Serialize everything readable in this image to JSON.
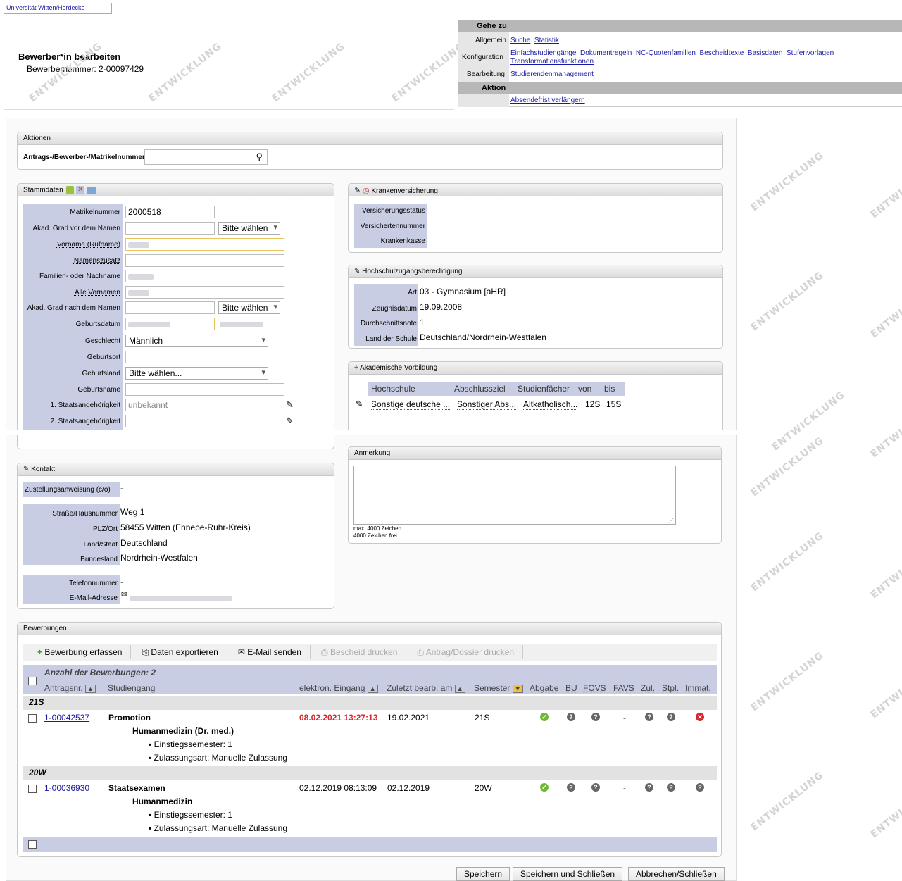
{
  "top": {
    "university_link": "Universität Witten/Herdecke",
    "page_title": "Bewerber*in bearbeiten",
    "applicant_number": "Bewerbernummer: 2-00097429",
    "watermark": "ENTWICKLUNG"
  },
  "nav": {
    "goto_header": "Gehe zu",
    "allgemein_label": "Allgemein",
    "allgemein_links": [
      "Suche",
      "Statistik"
    ],
    "konfiguration_label": "Konfiguration",
    "konfiguration_links": [
      "Einfachstudiengänge",
      "Dokumentregeln",
      "NC-Quotenfamilien",
      "Bescheidtexte",
      "Basisdaten",
      "Stufenvorlagen",
      "Transformationsfunktionen"
    ],
    "bearbeitung_label": "Bearbeitung",
    "bearbeitung_links": [
      "Studierendenmanagement"
    ],
    "aktion_header": "Aktion",
    "aktion_links": [
      "Absendefrist verlängern"
    ]
  },
  "aktionen": {
    "title": "Aktionen",
    "search_label": "Antrags-/Bewerber-/Matrikelnummer",
    "search_value": ""
  },
  "stammdaten": {
    "title": "Stammdaten",
    "fields": {
      "matrikelnummer_label": "Matrikelnummer",
      "matrikelnummer_value": "2000518",
      "grad_vor_label": "Akad. Grad vor dem Namen",
      "grad_vor_select": "Bitte wählen",
      "vorname_label": "Vorname (Rufname)",
      "namenszusatz_label": "Namenszusatz",
      "familienname_label": "Familien- oder Nachname",
      "alle_vornamen_label": "Alle Vornamen",
      "grad_nach_label": "Akad. Grad nach dem Namen",
      "grad_nach_select": "Bitte wählen",
      "geburtsdatum_label": "Geburtsdatum",
      "geschlecht_label": "Geschlecht",
      "geschlecht_value": "Männlich",
      "geburtsort_label": "Geburtsort",
      "geburtsland_label": "Geburtsland",
      "geburtsland_value": "Bitte wählen...",
      "geburtsname_label": "Geburtsname",
      "staat1_label": "1. Staatsangehörigkeit",
      "staat1_value": "unbekannt",
      "staat2_label": "2. Staatsangehörigkeit"
    }
  },
  "kranken": {
    "title": "Krankenversicherung",
    "status_label": "Versicherungsstatus",
    "nummer_label": "Versichertennummer",
    "kasse_label": "Krankenkasse"
  },
  "hzb": {
    "title": "Hochschulzugangsberechtigung",
    "art_label": "Art",
    "art_value": "03 - Gymnasium [aHR]",
    "datum_label": "Zeugnisdatum",
    "datum_value": "19.09.2008",
    "note_label": "Durchschnittsnote",
    "note_value": "1",
    "land_label": "Land der Schule",
    "land_value": "Deutschland/Nordrhein-Westfalen"
  },
  "vorbildung": {
    "title": "Akademische Vorbildung",
    "headers": [
      "Hochschule",
      "Abschlussziel",
      "Studienfächer",
      "von",
      "bis"
    ],
    "row": [
      "Sonstige deutsche ...",
      "Sonstiger Abs...",
      "Altkatholisch...",
      "12S",
      "15S"
    ]
  },
  "kontakt": {
    "title": "Kontakt",
    "zustellung_label": "Zustellungsanweisung (c/o)",
    "zustellung_value": "-",
    "strasse_label": "Straße/Hausnummer",
    "strasse_value": "Weg 1",
    "plz_label": "PLZ/Ort",
    "plz_value": "58455 Witten (Ennepe-Ruhr-Kreis)",
    "land_label": "Land/Staat",
    "land_value": "Deutschland",
    "bundesland_label": "Bundesland",
    "bundesland_value": "Nordrhein-Westfalen",
    "telefon_label": "Telefonnummer",
    "telefon_value": "-",
    "email_label": "E-Mail-Adresse"
  },
  "anmerkung": {
    "title": "Anmerkung",
    "max": "max. 4000 Zeichen",
    "frei": "4000 Zeichen frei"
  },
  "bewerbungen": {
    "title": "Bewerbungen",
    "toolbar": [
      "Bewerbung erfassen",
      "Daten exportieren",
      "E-Mail senden",
      "Bescheid drucken",
      "Antrag/Dossier drucken"
    ],
    "count": "Anzahl der Bewerbungen: 2",
    "headers": [
      "Antragsnr.",
      "Studiengang",
      "elektron. Eingang",
      "Zuletzt bearb. am",
      "Semester",
      "Abgabe",
      "BU",
      "FOVS",
      "FAVS",
      "Zul.",
      "Stpl.",
      "Immat."
    ],
    "groups": [
      {
        "semester": "21S",
        "nr": "1-00042537",
        "abschluss": "Promotion",
        "fach": "Humanmedizin (Dr. med.)",
        "bullets": [
          "Einstiegssemester: 1",
          "Zulassungsart: Manuelle Zulassung"
        ],
        "eingang": "08.02.2021 13:27:13",
        "bearb": "19.02.2021",
        "sem": "21S",
        "favs": "-"
      },
      {
        "semester": "20W",
        "nr": "1-00036930",
        "abschluss": "Staatsexamen",
        "fach": "Humanmedizin",
        "bullets": [
          "Einstiegssemester: 1",
          "Zulassungsart: Manuelle Zulassung"
        ],
        "eingang": "02.12.2019 08:13:09",
        "bearb": "02.12.2019",
        "sem": "20W",
        "favs": "-"
      }
    ]
  },
  "buttons": {
    "save": "Speichern",
    "save_close": "Speichern und Schließen",
    "cancel": "Abbrechen/Schließen"
  },
  "colors": {
    "label_bg": "#c9cde3",
    "nav_header": "#b4b4b4",
    "strike_red": "#d9262d"
  }
}
